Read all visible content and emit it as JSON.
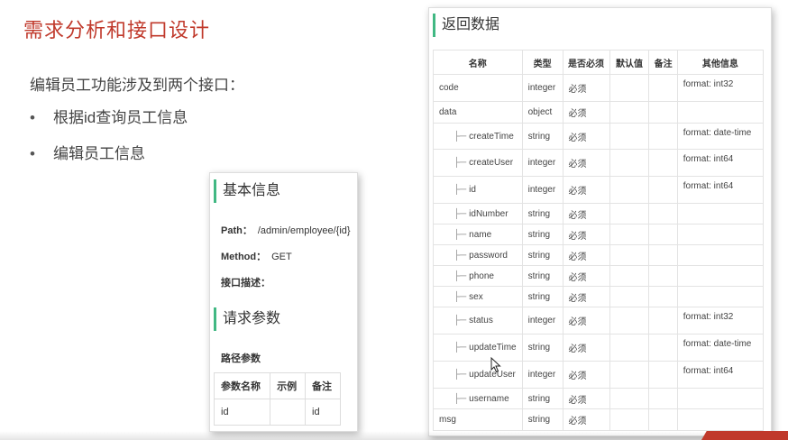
{
  "slide": {
    "title": "需求分析和接口设计",
    "intro": "编辑员工功能涉及到两个接口：",
    "bullets": [
      "根据id查询员工信息",
      "编辑员工信息"
    ]
  },
  "api_card": {
    "basic_info_title": "基本信息",
    "path_label": "Path：",
    "path_value": "/admin/employee/{id}",
    "method_label": "Method：",
    "method_value": "GET",
    "desc_label": "接口描述：",
    "request_params_title": "请求参数",
    "path_params_label": "路径参数",
    "params_table": {
      "headers": [
        "参数名称",
        "示例",
        "备注"
      ],
      "rows": [
        [
          "id",
          "",
          "id"
        ]
      ]
    }
  },
  "response_card": {
    "title": "返回数据",
    "headers": [
      "名称",
      "类型",
      "是否必须",
      "默认值",
      "备注",
      "其他信息"
    ],
    "indent_mark": "├─",
    "rows": [
      {
        "name": "code",
        "type": "integer",
        "required": "必须",
        "default": "",
        "note": "",
        "info": "format: int32",
        "child": false
      },
      {
        "name": "data",
        "type": "object",
        "required": "必须",
        "default": "",
        "note": "",
        "info": "",
        "child": false
      },
      {
        "name": "createTime",
        "type": "string",
        "required": "必须",
        "default": "",
        "note": "",
        "info": "format: date-time",
        "child": true
      },
      {
        "name": "createUser",
        "type": "integer",
        "required": "必须",
        "default": "",
        "note": "",
        "info": "format: int64",
        "child": true
      },
      {
        "name": "id",
        "type": "integer",
        "required": "必须",
        "default": "",
        "note": "",
        "info": "format: int64",
        "child": true
      },
      {
        "name": "idNumber",
        "type": "string",
        "required": "必须",
        "default": "",
        "note": "",
        "info": "",
        "child": true
      },
      {
        "name": "name",
        "type": "string",
        "required": "必须",
        "default": "",
        "note": "",
        "info": "",
        "child": true
      },
      {
        "name": "password",
        "type": "string",
        "required": "必须",
        "default": "",
        "note": "",
        "info": "",
        "child": true
      },
      {
        "name": "phone",
        "type": "string",
        "required": "必须",
        "default": "",
        "note": "",
        "info": "",
        "child": true
      },
      {
        "name": "sex",
        "type": "string",
        "required": "必须",
        "default": "",
        "note": "",
        "info": "",
        "child": true
      },
      {
        "name": "status",
        "type": "integer",
        "required": "必须",
        "default": "",
        "note": "",
        "info": "format: int32",
        "child": true
      },
      {
        "name": "updateTime",
        "type": "string",
        "required": "必须",
        "default": "",
        "note": "",
        "info": "format: date-time",
        "child": true
      },
      {
        "name": "updateUser",
        "type": "integer",
        "required": "必须",
        "default": "",
        "note": "",
        "info": "format: int64",
        "child": true
      },
      {
        "name": "username",
        "type": "string",
        "required": "必须",
        "default": "",
        "note": "",
        "info": "",
        "child": true
      },
      {
        "name": "msg",
        "type": "string",
        "required": "必须",
        "default": "",
        "note": "",
        "info": "",
        "child": false
      }
    ]
  },
  "colors": {
    "accent_title": "#c0392b",
    "section_bar": "#41b883"
  }
}
